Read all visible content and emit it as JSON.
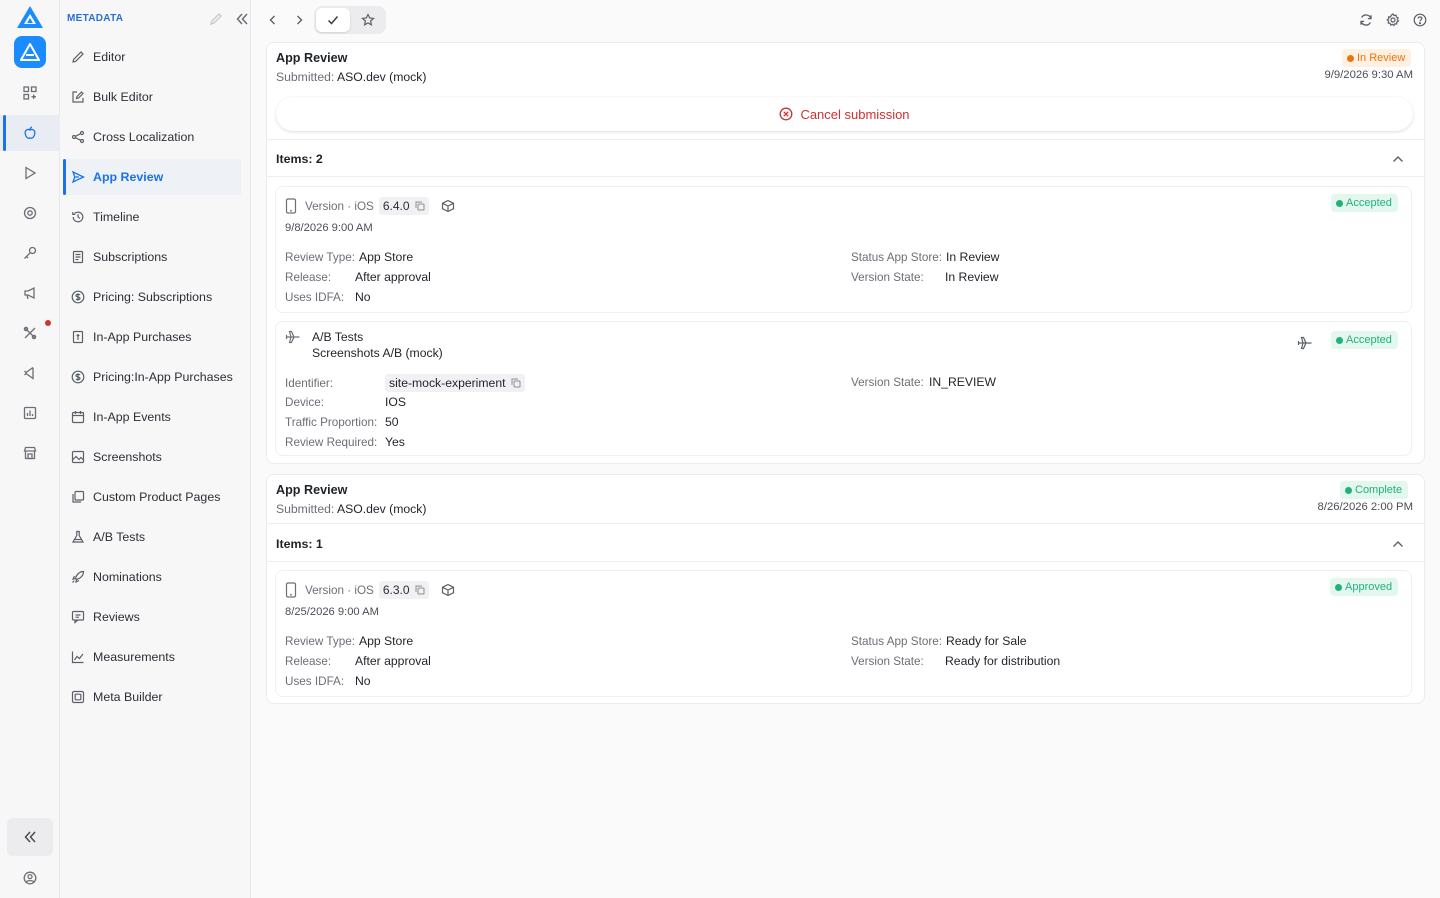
{
  "nav": {
    "section_title": "METADATA",
    "items": [
      {
        "label": "Editor",
        "icon": "pencil-icon"
      },
      {
        "label": "Bulk Editor",
        "icon": "edit-square-icon"
      },
      {
        "label": "Cross Localization",
        "icon": "share-nodes-icon"
      },
      {
        "label": "App Review",
        "icon": "send-icon",
        "active": true
      },
      {
        "label": "Timeline",
        "icon": "history-icon"
      },
      {
        "label": "Subscriptions",
        "icon": "document-list-icon"
      },
      {
        "label": "Pricing: Subscriptions",
        "icon": "dollar-circle-icon"
      },
      {
        "label": "In-App Purchases",
        "icon": "receipt-icon"
      },
      {
        "label": "Pricing:In-App Purchases",
        "icon": "dollar-circle-icon"
      },
      {
        "label": "In-App Events",
        "icon": "calendar-icon"
      },
      {
        "label": "Screenshots",
        "icon": "image-icon"
      },
      {
        "label": "Custom Product Pages",
        "icon": "layers-image-icon"
      },
      {
        "label": "A/B Tests",
        "icon": "flask-icon"
      },
      {
        "label": "Nominations",
        "icon": "rocket-icon"
      },
      {
        "label": "Reviews",
        "icon": "review-chat-icon"
      },
      {
        "label": "Measurements",
        "icon": "chart-line-icon"
      },
      {
        "label": "Meta Builder",
        "icon": "chip-icon"
      }
    ]
  },
  "colors": {
    "accent": "#1a73e8",
    "danger": "#d03030",
    "warning": "#e8770f",
    "success": "#20b27a"
  },
  "submissions": [
    {
      "title": "App Review",
      "submitted_label": "Submitted:",
      "submitted_by": "ASO.dev (mock)",
      "status": "In Review",
      "date": "9/9/2026 9:30 AM",
      "cancel_label": "Cancel submission",
      "items_label": "Items: 2",
      "version": {
        "type_label": "Version · iOS",
        "number": "6.4.0",
        "date": "9/8/2026 9:00 AM",
        "status": "Accepted",
        "review_type_label": "Review Type:",
        "review_type": "App Store",
        "release_label": "Release:",
        "release": "After approval",
        "idfa_label": "Uses IDFA:",
        "idfa": "No",
        "store_status_label": "Status App Store:",
        "store_status": "In Review",
        "version_state_label": "Version State:",
        "version_state": "In Review"
      },
      "ab_test": {
        "title": "A/B Tests",
        "name": "Screenshots A/B (mock)",
        "status": "Accepted",
        "identifier_label": "Identifier:",
        "identifier": "site-mock-experiment",
        "device_label": "Device:",
        "device": "IOS",
        "traffic_label": "Traffic Proportion:",
        "traffic": "50",
        "review_required_label": "Review Required:",
        "review_required": "Yes",
        "version_state_label": "Version State:",
        "version_state": "IN_REVIEW"
      }
    },
    {
      "title": "App Review",
      "submitted_label": "Submitted:",
      "submitted_by": "ASO.dev (mock)",
      "status": "Complete",
      "date": "8/26/2026 2:00 PM",
      "items_label": "Items: 1",
      "version": {
        "type_label": "Version · iOS",
        "number": "6.3.0",
        "date": "8/25/2026 9:00 AM",
        "status": "Approved",
        "review_type_label": "Review Type:",
        "review_type": "App Store",
        "release_label": "Release:",
        "release": "After approval",
        "idfa_label": "Uses IDFA:",
        "idfa": "No",
        "store_status_label": "Status App Store:",
        "store_status": "Ready for Sale",
        "version_state_label": "Version State:",
        "version_state": "Ready for distribution"
      }
    }
  ]
}
